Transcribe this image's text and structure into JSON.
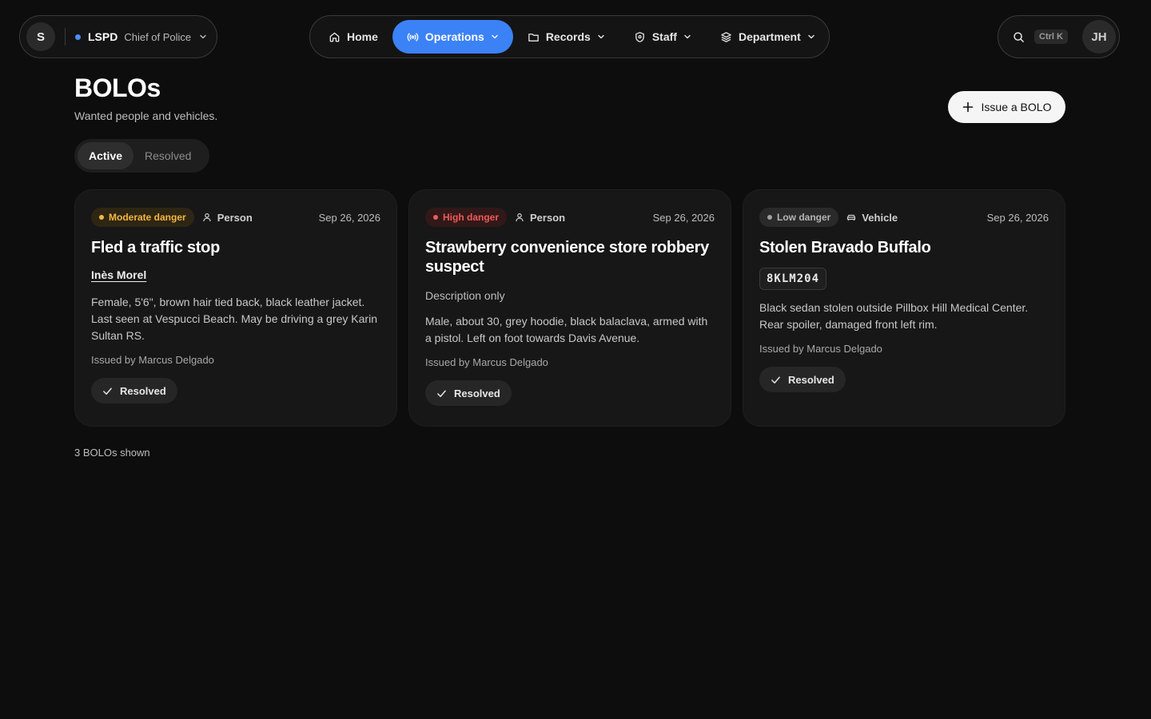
{
  "org": {
    "avatar": "S",
    "name": "LSPD",
    "role": "Chief of Police"
  },
  "nav": {
    "home": "Home",
    "operations": "Operations",
    "records": "Records",
    "staff": "Staff",
    "department": "Department"
  },
  "search": {
    "shortcut": "Ctrl K"
  },
  "user": {
    "initials": "JH"
  },
  "page": {
    "title": "BOLOs",
    "subtitle": "Wanted people and vehicles.",
    "issue_label": "Issue a BOLO"
  },
  "tabs": {
    "active": "Active",
    "resolved": "Resolved"
  },
  "cards": [
    {
      "danger": "Moderate danger",
      "danger_color": "#f5b642",
      "type": "Person",
      "type_icon": "person-icon",
      "date": "Sep 26, 2026",
      "title": "Fled a traffic stop",
      "subject": "Inès Morel",
      "description": "Female, 5'6\", brown hair tied back, black leather jacket. Last seen at Vespucci Beach. May be driving a grey Karin Sultan RS.",
      "issuer": "Issued by Marcus Delgado",
      "action": "Resolved"
    },
    {
      "danger": "High danger",
      "danger_color": "#f05a5a",
      "type": "Person",
      "type_icon": "person-icon",
      "date": "Sep 26, 2026",
      "title": "Strawberry convenience store robbery suspect",
      "subject_note": "Description only",
      "description": "Male, about 30, grey hoodie, black balaclava, armed with a pistol. Left on foot towards Davis Avenue.",
      "issuer": "Issued by Marcus Delgado",
      "action": "Resolved"
    },
    {
      "danger": "Low danger",
      "danger_color": "#a0a0a0",
      "type": "Vehicle",
      "type_icon": "car-icon",
      "date": "Sep 26, 2026",
      "title": "Stolen Bravado Buffalo",
      "plate": "8KLM204",
      "description": "Black sedan stolen outside Pillbox Hill Medical Center. Rear spoiler, damaged front left rim.",
      "issuer": "Issued by Marcus Delgado",
      "action": "Resolved"
    }
  ],
  "footer": {
    "count": "3 BOLOs shown"
  },
  "colors": {
    "accent": "#3b82f6",
    "background": "#0d0d0d",
    "card": "#171717"
  }
}
